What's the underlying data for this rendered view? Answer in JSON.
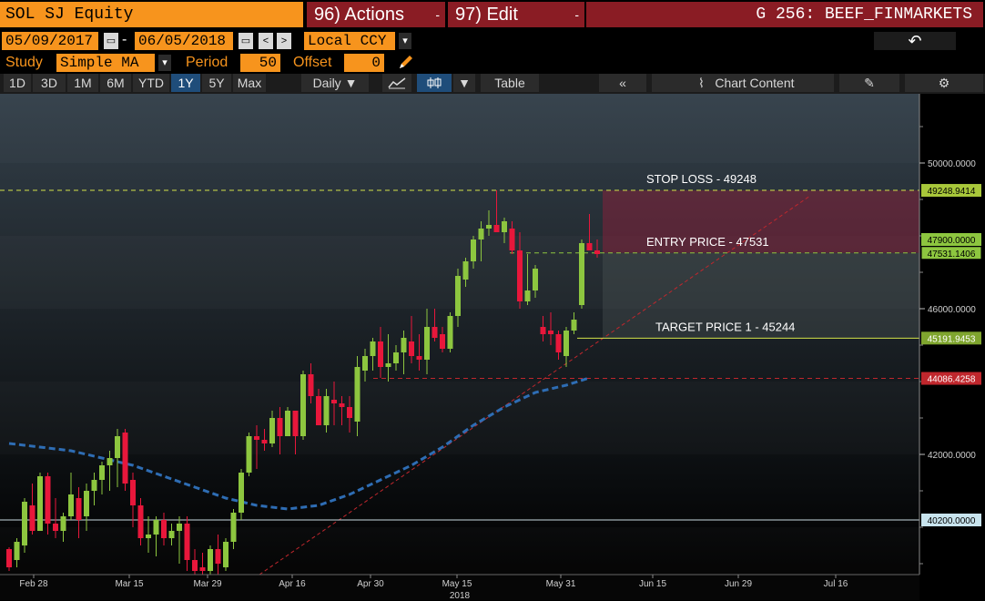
{
  "header": {
    "ticker": "SOL SJ Equity",
    "actions": "96) Actions",
    "edit": "97) Edit",
    "graph_title": "G 256: BEEF_FINMARKETS",
    "dd_arrow": "-"
  },
  "range": {
    "start": "05/09/2017",
    "dash": "-",
    "end": "06/05/2018",
    "currency": "Local CCY",
    "prev": "<",
    "next": ">"
  },
  "study": {
    "label": "Study",
    "value": "Simple MA",
    "period_label": "Period",
    "period": "50",
    "offset_label": "Offset",
    "offset": "0"
  },
  "toolbar": {
    "periods": [
      "1D",
      "3D",
      "1M",
      "6M",
      "YTD",
      "1Y",
      "5Y",
      "Max"
    ],
    "active_period": "1Y",
    "frequency": "Daily ▼",
    "table": "Table",
    "collapse": "«",
    "chart_content": "Chart Content",
    "back": "↶"
  },
  "colors": {
    "up": "#8dc63f",
    "down": "#e8173b",
    "ma": "#2e6db4",
    "stop": "#d4e34a",
    "entry": "#8dc63f",
    "support": "#c0272d"
  },
  "chart_data": {
    "type": "candlestick",
    "x_ticks": [
      "Feb 28",
      "Mar 15",
      "Mar 29",
      "Apr 16",
      "Apr 30",
      "May 15",
      "May 31",
      "Jun 15",
      "Jun 29",
      "Jul 16"
    ],
    "x_year": "2018",
    "y_ticks": [
      {
        "value": 42000,
        "label": "42000.0000"
      },
      {
        "value": 46000,
        "label": "46000.0000"
      },
      {
        "value": 50000,
        "label": "50000.0000"
      }
    ],
    "ylim": [
      38700,
      51900
    ],
    "candles": [
      [
        39400,
        39450,
        38800,
        38900
      ],
      [
        39100,
        39700,
        38900,
        39600
      ],
      [
        39500,
        40800,
        39300,
        40700
      ],
      [
        40600,
        41200,
        39800,
        39900
      ],
      [
        39900,
        41500,
        39900,
        41400
      ],
      [
        41400,
        41500,
        39800,
        40100
      ],
      [
        40100,
        40800,
        39700,
        39900
      ],
      [
        39900,
        40400,
        39600,
        40300
      ],
      [
        40300,
        41500,
        40200,
        40900
      ],
      [
        40800,
        41100,
        39700,
        40200
      ],
      [
        40300,
        41200,
        39900,
        41000
      ],
      [
        41000,
        41500,
        40600,
        41300
      ],
      [
        41300,
        41800,
        40900,
        41700
      ],
      [
        41700,
        42100,
        41000,
        41900
      ],
      [
        41900,
        42700,
        41100,
        42500
      ],
      [
        42600,
        42700,
        41000,
        41200
      ],
      [
        41300,
        41500,
        40000,
        40600
      ],
      [
        40600,
        40800,
        39500,
        39700
      ],
      [
        39700,
        40300,
        39300,
        39800
      ],
      [
        39800,
        40300,
        39200,
        40200
      ],
      [
        40200,
        40400,
        39500,
        39700
      ],
      [
        39700,
        40100,
        39500,
        39900
      ],
      [
        39900,
        40300,
        39000,
        40100
      ],
      [
        40100,
        40300,
        38800,
        39100
      ],
      [
        39100,
        39400,
        38700,
        38800
      ],
      [
        38900,
        39300,
        38700,
        38800
      ],
      [
        38800,
        39500,
        38700,
        39400
      ],
      [
        39400,
        39800,
        38700,
        39000
      ],
      [
        38900,
        39700,
        38800,
        39600
      ],
      [
        39600,
        40500,
        39400,
        40400
      ],
      [
        40400,
        41600,
        40200,
        41500
      ],
      [
        41500,
        42600,
        41400,
        42500
      ],
      [
        42500,
        42800,
        41600,
        42400
      ],
      [
        42400,
        42700,
        42100,
        42300
      ],
      [
        42300,
        43200,
        42200,
        43000
      ],
      [
        43000,
        43300,
        42000,
        42500
      ],
      [
        42500,
        43300,
        42500,
        43200
      ],
      [
        43200,
        43200,
        42000,
        42500
      ],
      [
        42500,
        44300,
        42400,
        44200
      ],
      [
        44200,
        44500,
        43400,
        43600
      ],
      [
        43600,
        43800,
        42900,
        42800
      ],
      [
        42800,
        43800,
        42600,
        43600
      ],
      [
        43500,
        44000,
        42800,
        43400
      ],
      [
        43400,
        43600,
        42800,
        43300
      ],
      [
        43300,
        43600,
        42600,
        43000
      ],
      [
        42900,
        44700,
        42500,
        44400
      ],
      [
        44300,
        44900,
        44000,
        44700
      ],
      [
        44700,
        45200,
        44300,
        45100
      ],
      [
        45100,
        45500,
        44100,
        44400
      ],
      [
        44400,
        45300,
        44000,
        44500
      ],
      [
        44500,
        45000,
        44300,
        44800
      ],
      [
        44800,
        45400,
        44200,
        45200
      ],
      [
        45100,
        45800,
        44500,
        44700
      ],
      [
        44700,
        45300,
        44300,
        44600
      ],
      [
        44600,
        46000,
        44200,
        45500
      ],
      [
        45500,
        46000,
        45100,
        45200
      ],
      [
        45300,
        45500,
        44800,
        44900
      ],
      [
        44900,
        45900,
        44800,
        45800
      ],
      [
        45800,
        47100,
        45500,
        46900
      ],
      [
        46800,
        47400,
        46600,
        47300
      ],
      [
        47300,
        48000,
        47100,
        47900
      ],
      [
        47900,
        48400,
        47300,
        48200
      ],
      [
        48200,
        48700,
        48000,
        48300
      ],
      [
        48300,
        49250,
        48200,
        48100
      ],
      [
        48100,
        48500,
        47800,
        48400
      ],
      [
        48200,
        48400,
        47500,
        47600
      ],
      [
        47600,
        48100,
        46000,
        46200
      ],
      [
        46200,
        47500,
        46100,
        46500
      ],
      [
        46500,
        47200,
        46300,
        47100
      ],
      [
        45500,
        45800,
        45100,
        45300
      ],
      [
        45400,
        45900,
        45000,
        45300
      ],
      [
        45300,
        45400,
        44600,
        44800
      ],
      [
        44700,
        45500,
        44400,
        45400
      ],
      [
        45400,
        45900,
        45300,
        45700
      ],
      [
        46100,
        47900,
        46000,
        47800
      ],
      [
        47800,
        48600,
        47600,
        47600
      ],
      [
        47600,
        47900,
        47400,
        47500
      ]
    ],
    "ma_points": [
      [
        0,
        42300
      ],
      [
        8,
        42100
      ],
      [
        12,
        41900
      ],
      [
        16,
        41700
      ],
      [
        20,
        41400
      ],
      [
        24,
        41100
      ],
      [
        28,
        40800
      ],
      [
        32,
        40600
      ],
      [
        36,
        40500
      ],
      [
        40,
        40600
      ],
      [
        44,
        40900
      ],
      [
        48,
        41300
      ],
      [
        52,
        41700
      ],
      [
        56,
        42200
      ],
      [
        60,
        42800
      ],
      [
        64,
        43300
      ],
      [
        68,
        43700
      ],
      [
        72,
        43900
      ],
      [
        75,
        44100
      ]
    ],
    "levels": [
      {
        "name": "stop-loss",
        "label": "STOP LOSS - 49248",
        "tag": "49248.9414",
        "value": 49248.9414
      },
      {
        "name": "current-price",
        "label": "",
        "tag": "47900.0000",
        "value": 47900
      },
      {
        "name": "entry-price",
        "label": "ENTRY PRICE - 47531",
        "tag": "47531.1406",
        "value": 47531.1406
      },
      {
        "name": "target-price",
        "label": "TARGET PRICE 1 - 45244",
        "tag": "45191.9453",
        "value": 45191.9453
      },
      {
        "name": "support",
        "label": "",
        "tag": "44086.4258",
        "value": 44086.4258
      },
      {
        "name": "baseline",
        "label": "",
        "tag": "40200.0000",
        "value": 40200
      }
    ]
  }
}
